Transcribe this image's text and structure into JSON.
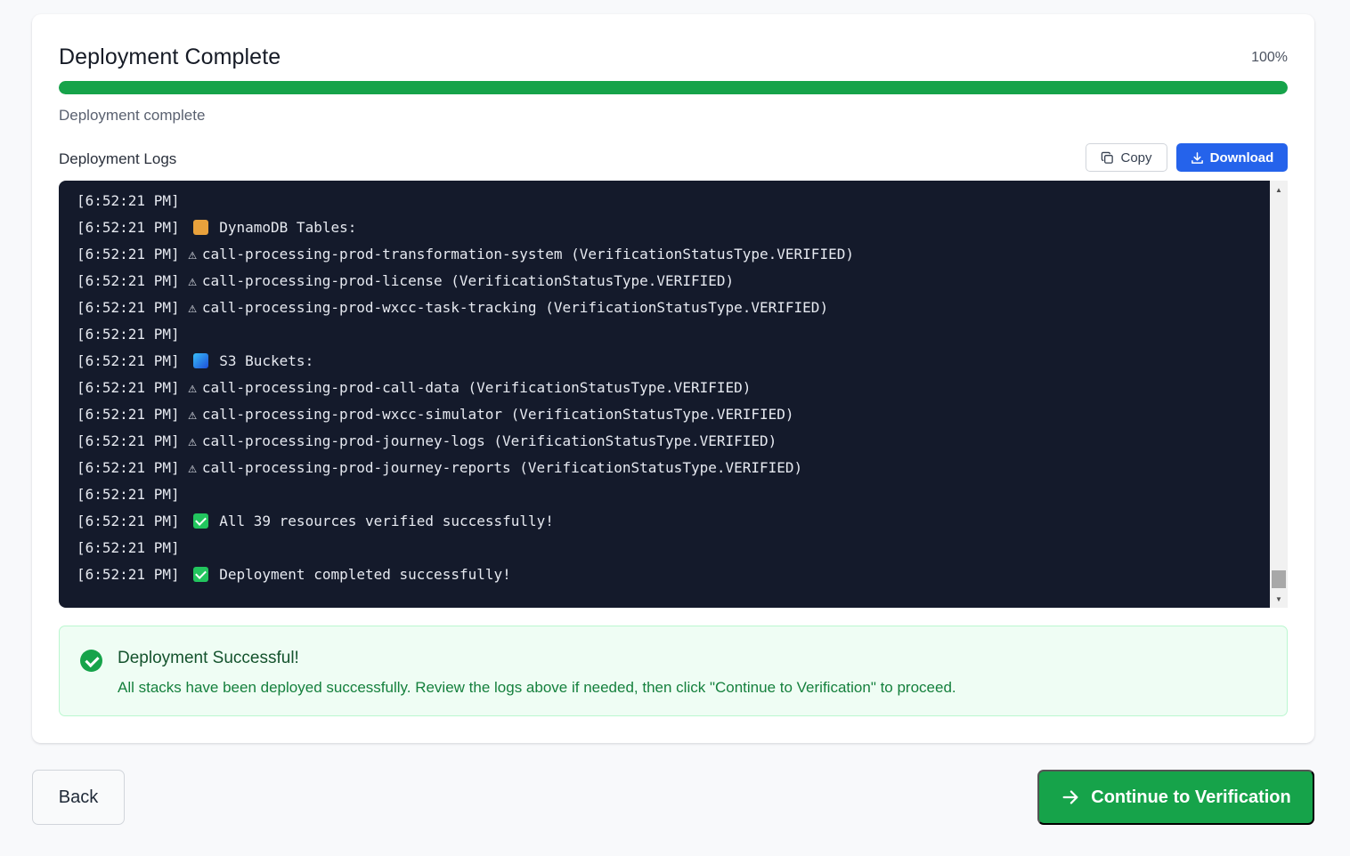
{
  "header": {
    "title": "Deployment Complete",
    "percent_label": "100%",
    "progress_fraction": 1.0,
    "status_text": "Deployment complete"
  },
  "logs": {
    "label": "Deployment Logs",
    "copy_label": "Copy",
    "download_label": "Download",
    "lines": [
      {
        "ts": "[6:52:21 PM]",
        "icon": "",
        "text": ""
      },
      {
        "ts": "[6:52:21 PM]",
        "icon": "package-icon",
        "text": "DynamoDB Tables:"
      },
      {
        "ts": "[6:52:21 PM]",
        "icon": "warning-icon",
        "text": "call-processing-prod-transformation-system (VerificationStatusType.VERIFIED)"
      },
      {
        "ts": "[6:52:21 PM]",
        "icon": "warning-icon",
        "text": "call-processing-prod-license (VerificationStatusType.VERIFIED)"
      },
      {
        "ts": "[6:52:21 PM]",
        "icon": "warning-icon",
        "text": "call-processing-prod-wxcc-task-tracking (VerificationStatusType.VERIFIED)"
      },
      {
        "ts": "[6:52:21 PM]",
        "icon": "",
        "text": ""
      },
      {
        "ts": "[6:52:21 PM]",
        "icon": "bucket-icon",
        "text": "S3 Buckets:"
      },
      {
        "ts": "[6:52:21 PM]",
        "icon": "warning-icon",
        "text": "call-processing-prod-call-data (VerificationStatusType.VERIFIED)"
      },
      {
        "ts": "[6:52:21 PM]",
        "icon": "warning-icon",
        "text": "call-processing-prod-wxcc-simulator (VerificationStatusType.VERIFIED)"
      },
      {
        "ts": "[6:52:21 PM]",
        "icon": "warning-icon",
        "text": "call-processing-prod-journey-logs (VerificationStatusType.VERIFIED)"
      },
      {
        "ts": "[6:52:21 PM]",
        "icon": "warning-icon",
        "text": "call-processing-prod-journey-reports (VerificationStatusType.VERIFIED)"
      },
      {
        "ts": "[6:52:21 PM]",
        "icon": "",
        "text": ""
      },
      {
        "ts": "[6:52:21 PM]",
        "icon": "check-icon",
        "text": "All 39 resources verified successfully!"
      },
      {
        "ts": "[6:52:21 PM]",
        "icon": "",
        "text": ""
      },
      {
        "ts": "[6:52:21 PM]",
        "icon": "check-icon",
        "text": "Deployment completed successfully!"
      }
    ]
  },
  "success": {
    "title": "Deployment Successful!",
    "message": "All stacks have been deployed successfully. Review the logs above if needed, then click \"Continue to Verification\" to proceed."
  },
  "footer": {
    "back_label": "Back",
    "continue_label": "Continue to Verification"
  },
  "colors": {
    "accent_green": "#16a34a",
    "accent_blue": "#2563eb",
    "terminal_bg": "#141a2b"
  }
}
